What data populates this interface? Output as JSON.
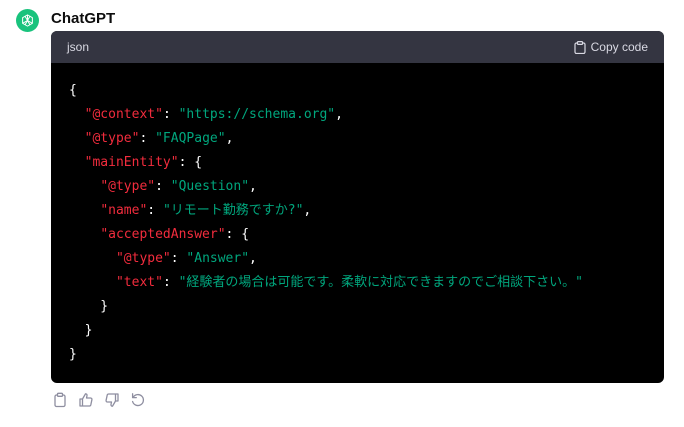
{
  "message": {
    "sender": "ChatGPT",
    "avatar_icon": "openai-logo-icon"
  },
  "code_block": {
    "language": "json",
    "copy_label": "Copy code",
    "lines": [
      [
        {
          "t": "{",
          "c": "p"
        }
      ],
      [
        {
          "t": "  ",
          "c": "p"
        },
        {
          "t": "\"@context\"",
          "c": "k"
        },
        {
          "t": ": ",
          "c": "p"
        },
        {
          "t": "\"https://schema.org\"",
          "c": "s"
        },
        {
          "t": ",",
          "c": "p"
        }
      ],
      [
        {
          "t": "  ",
          "c": "p"
        },
        {
          "t": "\"@type\"",
          "c": "k"
        },
        {
          "t": ": ",
          "c": "p"
        },
        {
          "t": "\"FAQPage\"",
          "c": "s"
        },
        {
          "t": ",",
          "c": "p"
        }
      ],
      [
        {
          "t": "  ",
          "c": "p"
        },
        {
          "t": "\"mainEntity\"",
          "c": "k"
        },
        {
          "t": ": {",
          "c": "p"
        }
      ],
      [
        {
          "t": "    ",
          "c": "p"
        },
        {
          "t": "\"@type\"",
          "c": "k"
        },
        {
          "t": ": ",
          "c": "p"
        },
        {
          "t": "\"Question\"",
          "c": "s"
        },
        {
          "t": ",",
          "c": "p"
        }
      ],
      [
        {
          "t": "    ",
          "c": "p"
        },
        {
          "t": "\"name\"",
          "c": "k"
        },
        {
          "t": ": ",
          "c": "p"
        },
        {
          "t": "\"リモート勤務ですか?\"",
          "c": "s"
        },
        {
          "t": ",",
          "c": "p"
        }
      ],
      [
        {
          "t": "    ",
          "c": "p"
        },
        {
          "t": "\"acceptedAnswer\"",
          "c": "k"
        },
        {
          "t": ": {",
          "c": "p"
        }
      ],
      [
        {
          "t": "      ",
          "c": "p"
        },
        {
          "t": "\"@type\"",
          "c": "k"
        },
        {
          "t": ": ",
          "c": "p"
        },
        {
          "t": "\"Answer\"",
          "c": "s"
        },
        {
          "t": ",",
          "c": "p"
        }
      ],
      [
        {
          "t": "      ",
          "c": "p"
        },
        {
          "t": "\"text\"",
          "c": "k"
        },
        {
          "t": ": ",
          "c": "p"
        },
        {
          "t": "\"経験者の場合は可能です。柔軟に対応できますのでご相談下さい。\"",
          "c": "s"
        }
      ],
      [
        {
          "t": "    }",
          "c": "p"
        }
      ],
      [
        {
          "t": "  }",
          "c": "p"
        }
      ],
      [
        {
          "t": "}",
          "c": "p"
        }
      ]
    ]
  },
  "actions": [
    {
      "name": "copy-icon"
    },
    {
      "name": "thumbs-up-icon"
    },
    {
      "name": "thumbs-down-icon"
    },
    {
      "name": "regenerate-icon"
    }
  ],
  "colors": {
    "avatar_bg": "#19c37d",
    "code_header_bg": "#343541",
    "code_bg": "#000000",
    "key": "#f22c3d",
    "string": "#00a67d"
  }
}
